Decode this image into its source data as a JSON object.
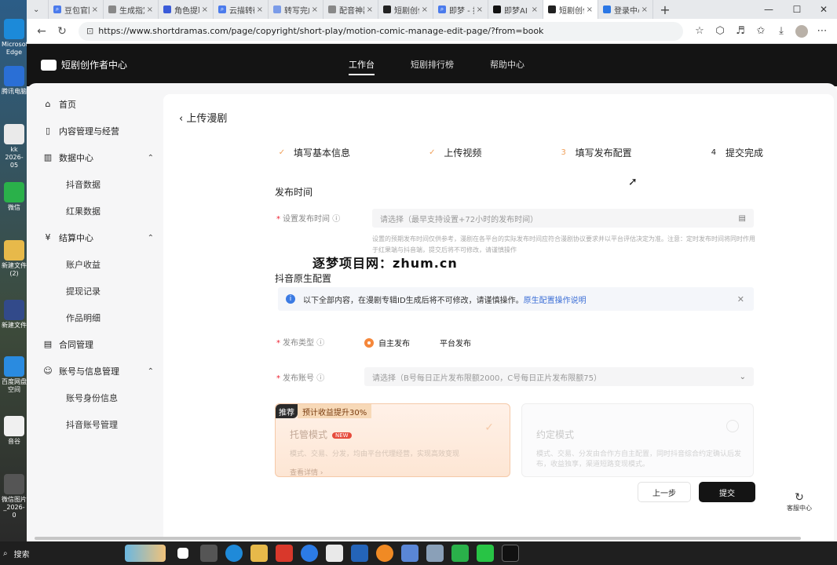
{
  "desktop": [
    {
      "label": "Microsoft Edge"
    },
    {
      "label": "腾讯电脑"
    },
    {
      "label": "kk 2026-05"
    },
    {
      "label": "微信"
    },
    {
      "label": "新建文件 (2)"
    },
    {
      "label": "新建文件"
    },
    {
      "label": "百度网盘 空间"
    },
    {
      "label": "音谷"
    },
    {
      "label": "微信图片 _2026-0"
    }
  ],
  "browser": {
    "tabs": [
      {
        "label": "豆包官网",
        "color": "#4b7bec"
      },
      {
        "label": "生成指定",
        "color": "#888888"
      },
      {
        "label": "角色提取",
        "color": "#3a5bd9"
      },
      {
        "label": "云描转码",
        "color": "#4b7bec"
      },
      {
        "label": "转写完成",
        "color": "#7a9be8"
      },
      {
        "label": "配音神器",
        "color": "#888888"
      },
      {
        "label": "短剧创作",
        "color": "#222222"
      },
      {
        "label": "即梦 - 推",
        "color": "#4b7bec"
      },
      {
        "label": "即梦AI -",
        "color": "#111111"
      },
      {
        "label": "短剧创作",
        "color": "#222222"
      },
      {
        "label": "登录中心",
        "color": "#2b77e5"
      }
    ],
    "url": "https://www.shortdramas.com/page/copyright/short-play/motion-comic-manage-edit-page/?from=book"
  },
  "site": {
    "logo": "短剧创作者中心",
    "nav": [
      "工作台",
      "短剧排行榜",
      "帮助中心"
    ]
  },
  "sidebar": [
    {
      "label": "首页",
      "icon": "home-icon",
      "glyph": "⌂",
      "sub": false
    },
    {
      "label": "内容管理与经营",
      "icon": "content-icon",
      "glyph": "▯",
      "sub": false
    },
    {
      "label": "数据中心",
      "icon": "chart-icon",
      "glyph": "▥",
      "sub": false,
      "chevron": "⌃"
    },
    {
      "label": "抖音数据",
      "sub": true
    },
    {
      "label": "红果数据",
      "sub": true
    },
    {
      "label": "结算中心",
      "icon": "settle-icon",
      "glyph": "¥",
      "sub": false,
      "chevron": "⌃"
    },
    {
      "label": "账户收益",
      "sub": true
    },
    {
      "label": "提现记录",
      "sub": true
    },
    {
      "label": "作品明细",
      "sub": true
    },
    {
      "label": "合同管理",
      "icon": "contract-icon",
      "glyph": "▤",
      "sub": false
    },
    {
      "label": "账号与信息管理",
      "icon": "account-icon",
      "glyph": "☺",
      "sub": false,
      "chevron": "⌃"
    },
    {
      "label": "账号身份信息",
      "sub": true
    },
    {
      "label": "抖音账号管理",
      "sub": true
    }
  ],
  "main": {
    "back_title": "上传漫剧",
    "steps": [
      {
        "num": "✓",
        "label": "填写基本信息",
        "done": true
      },
      {
        "num": "✓",
        "label": "上传视频",
        "done": true
      },
      {
        "num": "3",
        "label": "填写发布配置",
        "done": false
      },
      {
        "num": "4",
        "label": "提交完成",
        "done": false
      }
    ],
    "publish_time_title": "发布时间",
    "publish_time_label": "设置发布时间",
    "publish_time_placeholder": "请选择（最早支持设置+72小时的发布时间）",
    "publish_time_hint": "设置的预期发布时间仅供参考，漫剧在各平台的实际发布时间应符合漫剧协议要求并以平台评估决定为准。注意：定时发布时间将同时作用于红果端与抖音端，提交后将不可修改，请谨慎操作",
    "watermark": "逐梦项目网：zhum.cn",
    "native_title": "抖音原生配置",
    "notice_text": "以下全部内容，在漫剧专辑ID生成后将不可修改，请谨慎操作。",
    "notice_link": "原生配置操作说明",
    "publish_type_label": "发布类型",
    "publish_type_options": [
      "自主发布",
      "平台发布"
    ],
    "publish_account_label": "发布账号",
    "publish_account_placeholder": "请选择（B号每日正片发布限额2000，C号每日正片发布限额75）",
    "card1": {
      "tag": "推荐",
      "tag2": "预计收益提升30%",
      "title": "托管模式",
      "new": "NEW",
      "desc": "模式、交易、分发，均由平台代理经营，实现高效变现",
      "more": "查看详情 ›"
    },
    "card2": {
      "title": "约定模式",
      "desc": "模式、交易、分发由合作方自主配置，同时抖音综合约定确认后发布，收益独享，渠道短路变现模式。"
    },
    "prev_button": "上一步",
    "submit_button": "提交",
    "service": "客服中心"
  },
  "taskbar": {
    "search": "搜索"
  }
}
